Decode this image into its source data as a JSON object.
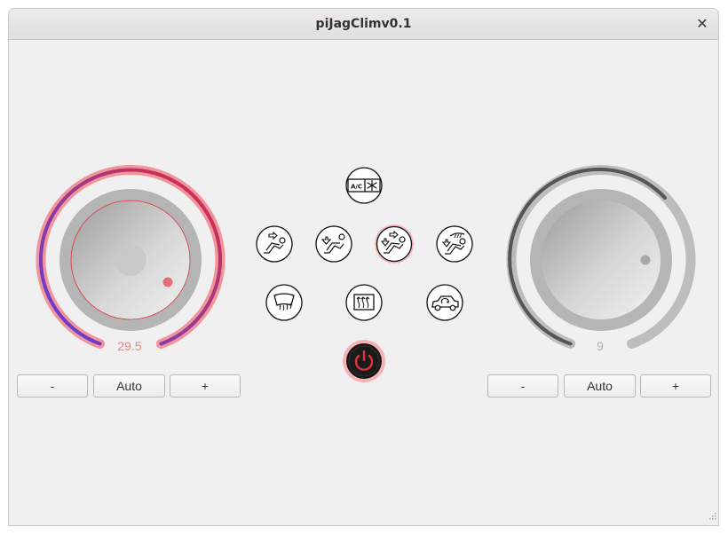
{
  "window": {
    "title": "piJagClimv0.1",
    "close_glyph": "✕"
  },
  "left_zone": {
    "temperature": "29.5",
    "level": 0.8,
    "accent": "#e0323c",
    "buttons": {
      "minus": "-",
      "auto": "Auto",
      "plus": "+"
    }
  },
  "right_zone": {
    "fan_speed": "9",
    "level": 0.75,
    "accent": "#555555",
    "buttons": {
      "minus": "-",
      "auto": "Auto",
      "plus": "+"
    }
  },
  "controls": {
    "ac": {
      "icon": "ac-snowflake-icon",
      "label_a": "A/C",
      "active": false
    },
    "airflow": [
      {
        "icon": "airflow-face-icon",
        "active": false
      },
      {
        "icon": "airflow-feet-icon",
        "active": false
      },
      {
        "icon": "airflow-face-feet-icon",
        "active": true
      },
      {
        "icon": "airflow-windshield-feet-icon",
        "active": false
      }
    ],
    "front_defrost": {
      "icon": "front-defrost-icon",
      "active": false
    },
    "rear_defrost": {
      "icon": "rear-defrost-icon",
      "active": false
    },
    "recirculation": {
      "icon": "recirculation-icon",
      "active": false
    },
    "power": {
      "icon": "power-icon",
      "active": true,
      "color": "#e0323c"
    }
  }
}
